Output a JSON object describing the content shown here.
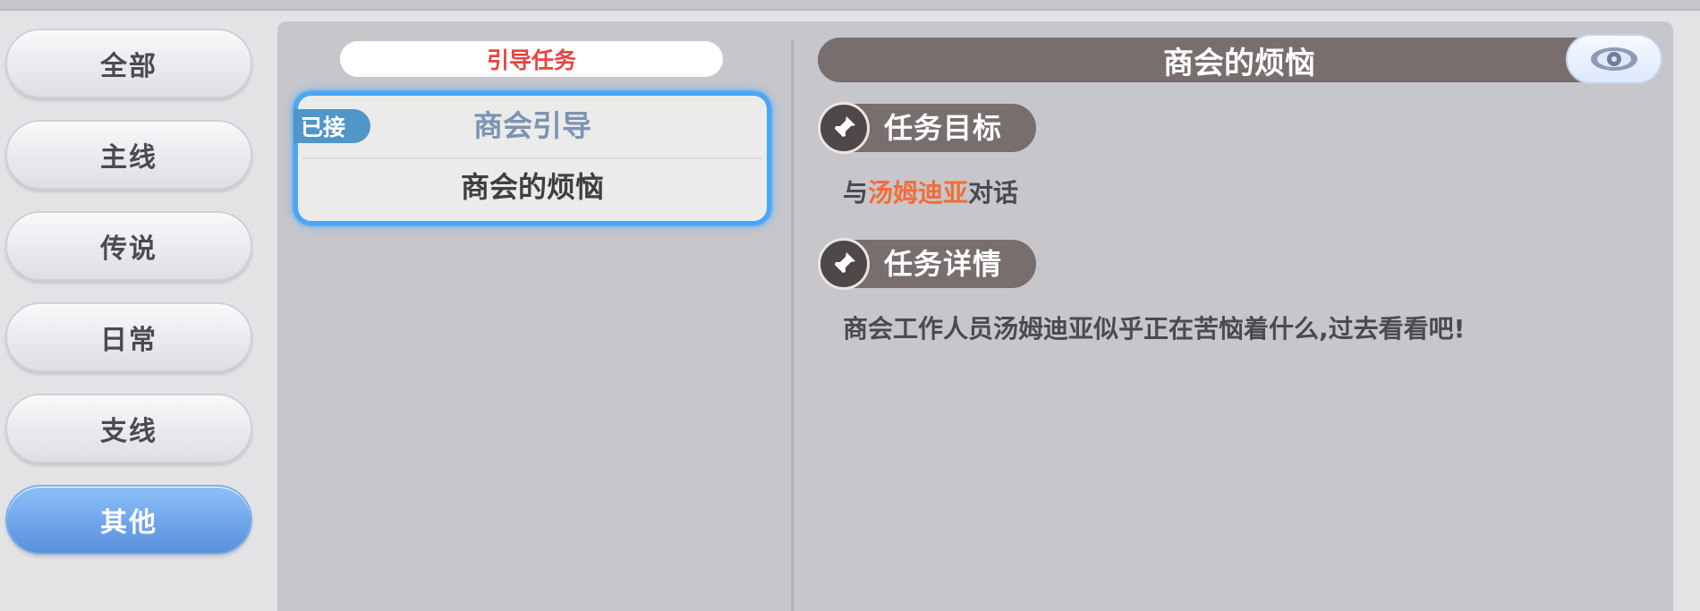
{
  "categories": [
    {
      "label": "全部",
      "active": false
    },
    {
      "label": "主线",
      "active": false
    },
    {
      "label": "传说",
      "active": false
    },
    {
      "label": "日常",
      "active": false
    },
    {
      "label": "支线",
      "active": false
    },
    {
      "label": "其他",
      "active": true
    }
  ],
  "quest_list": {
    "header": "引导任务",
    "selected_quest": {
      "badge": "已接",
      "category": "商会引导",
      "name": "商会的烦恼"
    }
  },
  "quest_detail": {
    "title": "商会的烦恼",
    "eye_icon": "eye-icon",
    "objective": {
      "label": "任务目标",
      "icon": "pin-icon",
      "text_before": "与",
      "npc": "汤姆迪亚",
      "text_after": "对话"
    },
    "details": {
      "label": "任务详情",
      "icon": "pin-icon",
      "text": "商会工作人员汤姆迪亚似乎正在苦恼着什么,过去看看吧!"
    }
  },
  "colors": {
    "accent_blue": "#4aa6f6",
    "active_tab": "#6ea4ea",
    "header_red": "#e8433e",
    "npc_orange": "#f36d35",
    "title_bar": "#776e6d"
  }
}
